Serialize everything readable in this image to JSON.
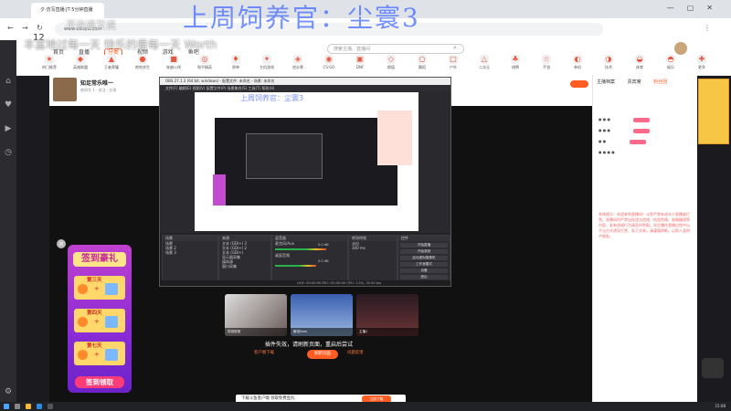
{
  "browser": {
    "tab_title": "夕·仿写直播·JT·5分钟直播",
    "url": "www.douyu.com"
  },
  "overlay": {
    "title": "上周饲养官：尘寰3",
    "line1": "不许逃又说",
    "line2": "丰富地过每一天 快乐的看每一天 Worth",
    "inner_title": "上周饲养官：尘寰3"
  },
  "site": {
    "nav": [
      "首页",
      "直播",
      "分类",
      "视频",
      "游戏",
      "鱼吧"
    ],
    "nav_active_index": 2,
    "search_placeholder": "搜索主播、直播间",
    "side_count": "12"
  },
  "categories": [
    "热门推荐",
    "英雄联盟",
    "王者荣耀",
    "绝地求生",
    "穿越火线",
    "和平精英",
    "原神",
    "主机游戏",
    "逆水寒",
    "CS:GO",
    "DNF",
    "颜值",
    "舞蹈",
    "户外",
    "二次元",
    "棋牌",
    "手游",
    "单机",
    "技术",
    "体育",
    "娱乐",
    "更多"
  ],
  "room": {
    "title": "知足常乐唯一",
    "subtitle": "房间号 1 · 关注 · 分享"
  },
  "chat": {
    "tabs": [
      "主播档案",
      "贵宾席",
      "粉丝团"
    ],
    "notice": "系统提示：欢迎来到直播间！斗鱼严禁未成年人直播或打赏。直播间内严禁出现违法违规、低俗色情、吸烟酗酒等内容，若有违规行为请及时举报。如主播在直播过程中以不当方式诱导打赏、私下交易，请谨慎判断，以防人身财产损失。"
  },
  "obs": {
    "title": "OBS 27.1.3 (64 bit, windows) - 配置文件: 未命名 - 场景: 未命名",
    "menu": "文件(F)  编辑(E)  视图(V)  配置文件(P)  场景集合(S)  工具(T)  帮助(H)",
    "docks": {
      "scene_header": "场景",
      "source_header": "来源",
      "mixer_header": "混音器",
      "transitions_header": "转场特效",
      "controls_header": "控件"
    },
    "scenes": [
      "场景",
      "场景 2",
      "场景 3"
    ],
    "sources": [
      "文本 (GDI+) 3",
      "文本 (GDI+) 2",
      "文本 (GDI+)",
      "显示器采集",
      "媒体源",
      "窗口采集"
    ],
    "mixer": [
      {
        "name": "麦克风/Aux",
        "db": "0.0 dB",
        "level": 0.78
      },
      {
        "name": "桌面音频",
        "db": "0.0 dB",
        "level": 0.62
      }
    ],
    "transition": "淡出",
    "transition_duration": "300 ms",
    "controls": [
      "开始直播",
      "开始录制",
      "启动虚拟摄像机",
      "工作室模式",
      "设置",
      "退出"
    ],
    "status": "LIVE: 00:00:00   REC: 00:00:00   CPU: 1.5%, 30.00 fps"
  },
  "recommend": {
    "cards": [
      "林斑斑斑",
      "解说Sam",
      "主播1"
    ],
    "plugin_line": "插件失效，请刷新页面，重启后尝试",
    "plugin_btn": "客户端下载",
    "reload_btn": "刷新页面",
    "feedback_btn": "问题反馈"
  },
  "signin": {
    "title": "签到豪礼",
    "days": [
      "第三天",
      "第四天",
      "第七天"
    ],
    "button": "签到领取",
    "close": "×"
  },
  "bottombar": {
    "text": "下载斗鱼客户端 领取免费鱼丸",
    "button": "立即下载"
  },
  "taskbar": {
    "time": "15:08"
  },
  "colors": {
    "brand": "#ff5d23",
    "obs_bg": "#2a2a2e",
    "signin_purple": "#8a2bd6"
  }
}
